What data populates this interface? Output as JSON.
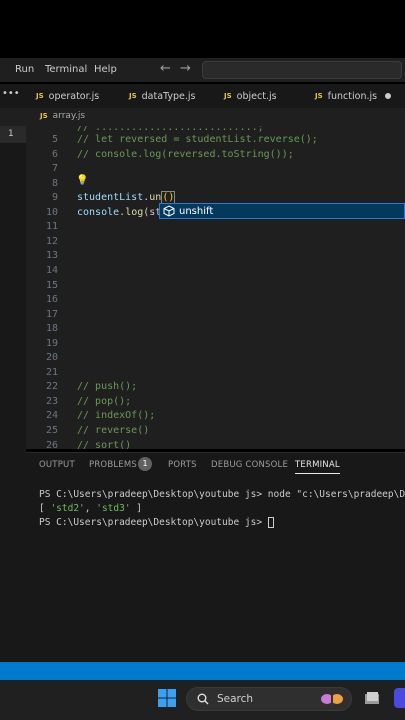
{
  "menubar": {
    "items": [
      "Run",
      "Terminal",
      "Help"
    ],
    "back_arrow": "←",
    "forward_arrow": "→"
  },
  "tabs": [
    {
      "badge": "JS",
      "label": "operator.js",
      "modified": false
    },
    {
      "badge": "JS",
      "label": "dataType.js",
      "modified": false
    },
    {
      "badge": "JS",
      "label": "object.js",
      "modified": false
    },
    {
      "badge": "JS",
      "label": "function.js",
      "modified": true
    }
  ],
  "more_icon": "•••",
  "breadcrumb": {
    "badge": "JS",
    "file": "array.js"
  },
  "activity": {
    "selected_number": "1"
  },
  "editor": {
    "lines": [
      {
        "n": "5",
        "text": "// let reversed = studentList.reverse();"
      },
      {
        "n": "6",
        "text": "// console.log(reversed.toString());"
      },
      {
        "n": "7",
        "text": ""
      },
      {
        "n": "8",
        "text": ""
      },
      {
        "n": "9",
        "text": "studentList.un()"
      },
      {
        "n": "10",
        "text": "console.log(st"
      },
      {
        "n": "11",
        "text": ""
      },
      {
        "n": "12",
        "text": ""
      },
      {
        "n": "13",
        "text": ""
      },
      {
        "n": "14",
        "text": ""
      },
      {
        "n": "15",
        "text": ""
      },
      {
        "n": "16",
        "text": ""
      },
      {
        "n": "17",
        "text": ""
      },
      {
        "n": "18",
        "text": ""
      },
      {
        "n": "19",
        "text": ""
      },
      {
        "n": "20",
        "text": ""
      },
      {
        "n": "21",
        "text": ""
      },
      {
        "n": "22",
        "text": "// push();"
      },
      {
        "n": "23",
        "text": "// pop();"
      },
      {
        "n": "24",
        "text": "// indexOf();"
      },
      {
        "n": "25",
        "text": "// reverse()"
      },
      {
        "n": "26",
        "text": "// sort()"
      }
    ],
    "line9": {
      "obj": "studentList",
      "dot": ".",
      "method": "un",
      "parens": "()"
    },
    "line10": {
      "obj": "console",
      "dot": ".",
      "method": "log",
      "rest": "(st"
    },
    "suggestion": "unshift"
  },
  "panel": {
    "tabs": [
      "OUTPUT",
      "PROBLEMS",
      "PORTS",
      "DEBUG CONSOLE",
      "TERMINAL"
    ],
    "problems_count": "1",
    "active_tab": "TERMINAL",
    "terminal": {
      "line1": "PS C:\\Users\\pradeep\\Desktop\\youtube js> node \"c:\\Users\\pradeep\\Desk",
      "line2_open": "[ ",
      "line2_s1": "'std2'",
      "line2_sep": ", ",
      "line2_s2": "'std3'",
      "line2_close": " ]",
      "line3": "PS C:\\Users\\pradeep\\Desktop\\youtube js> "
    }
  },
  "taskbar": {
    "search_placeholder": "Search"
  },
  "colors": {
    "statusbar": "#007acc",
    "comment": "#6a9955",
    "variable": "#9cdcfe",
    "function": "#dcdcaa",
    "suggest_bg": "#04395e"
  }
}
